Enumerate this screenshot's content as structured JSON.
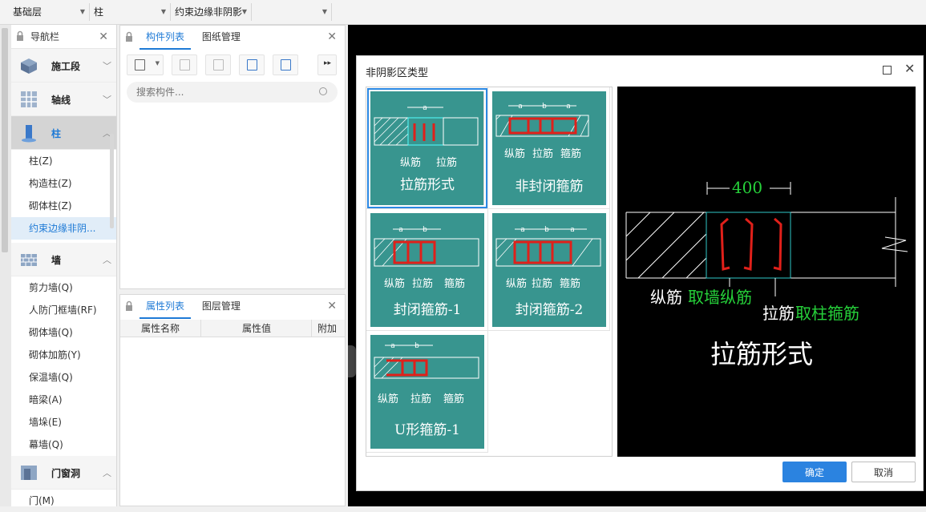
{
  "topbar": {
    "floor": "基础层",
    "category": "柱",
    "type": "约束边缘非阴影",
    "extra": ""
  },
  "nav": {
    "title": "导航栏",
    "categories": [
      {
        "label": "施工段"
      },
      {
        "label": "轴线"
      },
      {
        "label": "柱"
      },
      {
        "label": "墙"
      },
      {
        "label": "门窗洞"
      }
    ],
    "column_items": [
      "柱(Z)",
      "构造柱(Z)",
      "砌体柱(Z)",
      "约束边缘非阴..."
    ],
    "wall_items": [
      "剪力墙(Q)",
      "人防门框墙(RF)",
      "砌体墙(Q)",
      "砌体加筋(Y)",
      "保温墙(Q)",
      "暗梁(A)",
      "墙垛(E)",
      "幕墙(Q)"
    ],
    "door_items": [
      "门(M)"
    ]
  },
  "component_panel": {
    "tab_list": "构件列表",
    "tab_drawings": "图纸管理",
    "search_placeholder": "搜索构件..."
  },
  "property_panel": {
    "tab_props": "属性列表",
    "tab_layers": "图层管理",
    "col_name": "属性名称",
    "col_value": "属性值",
    "col_extra": "附加"
  },
  "dialog": {
    "title": "非阴影区类型",
    "options": [
      {
        "caption": "拉筋形式",
        "labels": [
          "纵筋",
          "拉筋"
        ],
        "dims": [
          "a"
        ],
        "selected": true
      },
      {
        "caption": "非封闭箍筋",
        "labels": [
          "纵筋",
          "拉筋",
          "箍筋"
        ],
        "dims": [
          "a",
          "b",
          "a"
        ],
        "selected": false
      },
      {
        "caption": "封闭箍筋-1",
        "labels": [
          "纵筋",
          "拉筋",
          "箍筋"
        ],
        "dims": [
          "a",
          "b"
        ],
        "selected": false
      },
      {
        "caption": "封闭箍筋-2",
        "labels": [
          "纵筋",
          "拉筋",
          "箍筋"
        ],
        "dims": [
          "a",
          "b",
          "a"
        ],
        "selected": false
      },
      {
        "caption": "U形箍筋-1",
        "labels": [
          "纵筋",
          "拉筋",
          "箍筋"
        ],
        "dims": [
          "a",
          "b"
        ],
        "selected": false
      }
    ],
    "preview": {
      "dimension": "400",
      "long_bar_label": "纵筋",
      "long_bar_note": "取墙纵筋",
      "tie_label": "拉筋",
      "tie_note": "取柱箍筋",
      "caption": "拉筋形式"
    },
    "ok": "确定",
    "cancel": "取消"
  },
  "colors": {
    "accent": "#1e7ad6",
    "card_teal": "#38958f",
    "rebar_red": "#e0201a",
    "cad_green": "#26d13a"
  }
}
